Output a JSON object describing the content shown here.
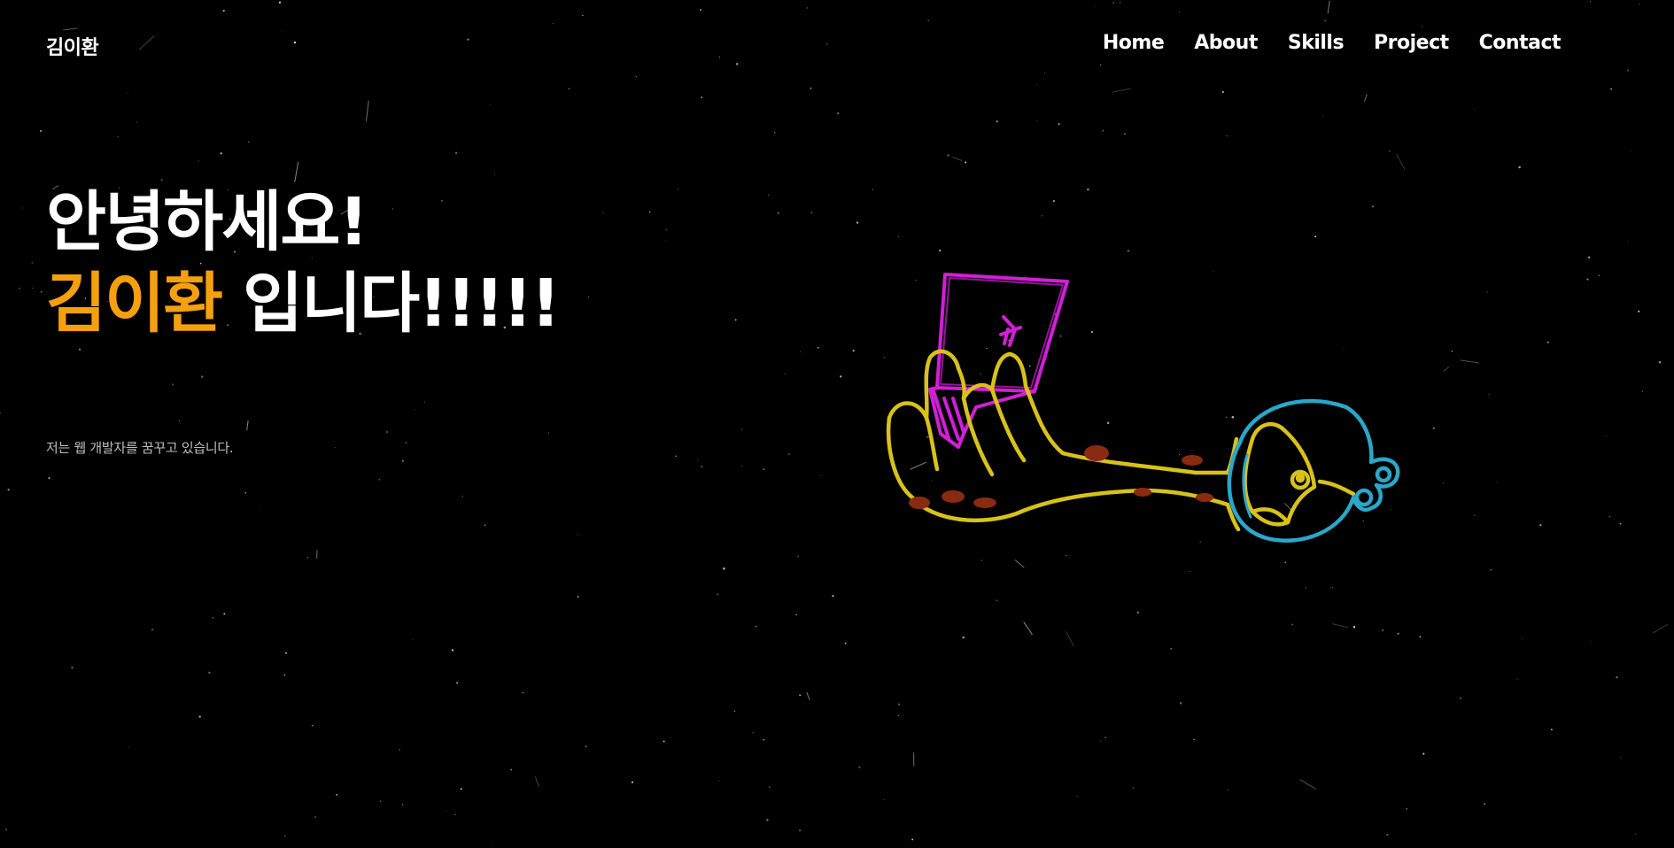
{
  "header": {
    "logo": "김이환",
    "nav": [
      "Home",
      "About",
      "Skills",
      "Project",
      "Contact"
    ]
  },
  "hero": {
    "greeting": "안녕하세요!",
    "name": "김이환",
    "suffix": " 입니다!!!!!",
    "subtitle": "저는 웹 개발자를 꿈꾸고 있습니다."
  },
  "colors": {
    "background": "#000000",
    "text": "#ffffff",
    "accent": "#f5a00e",
    "subtitle": "#bdbdbd",
    "book": "#d21fd6",
    "arm": "#d8c21a",
    "bubble": "#2aa7c9",
    "spots": "#8a2a10"
  },
  "illustration": {
    "icon": "hand-holding-book-illustration"
  }
}
